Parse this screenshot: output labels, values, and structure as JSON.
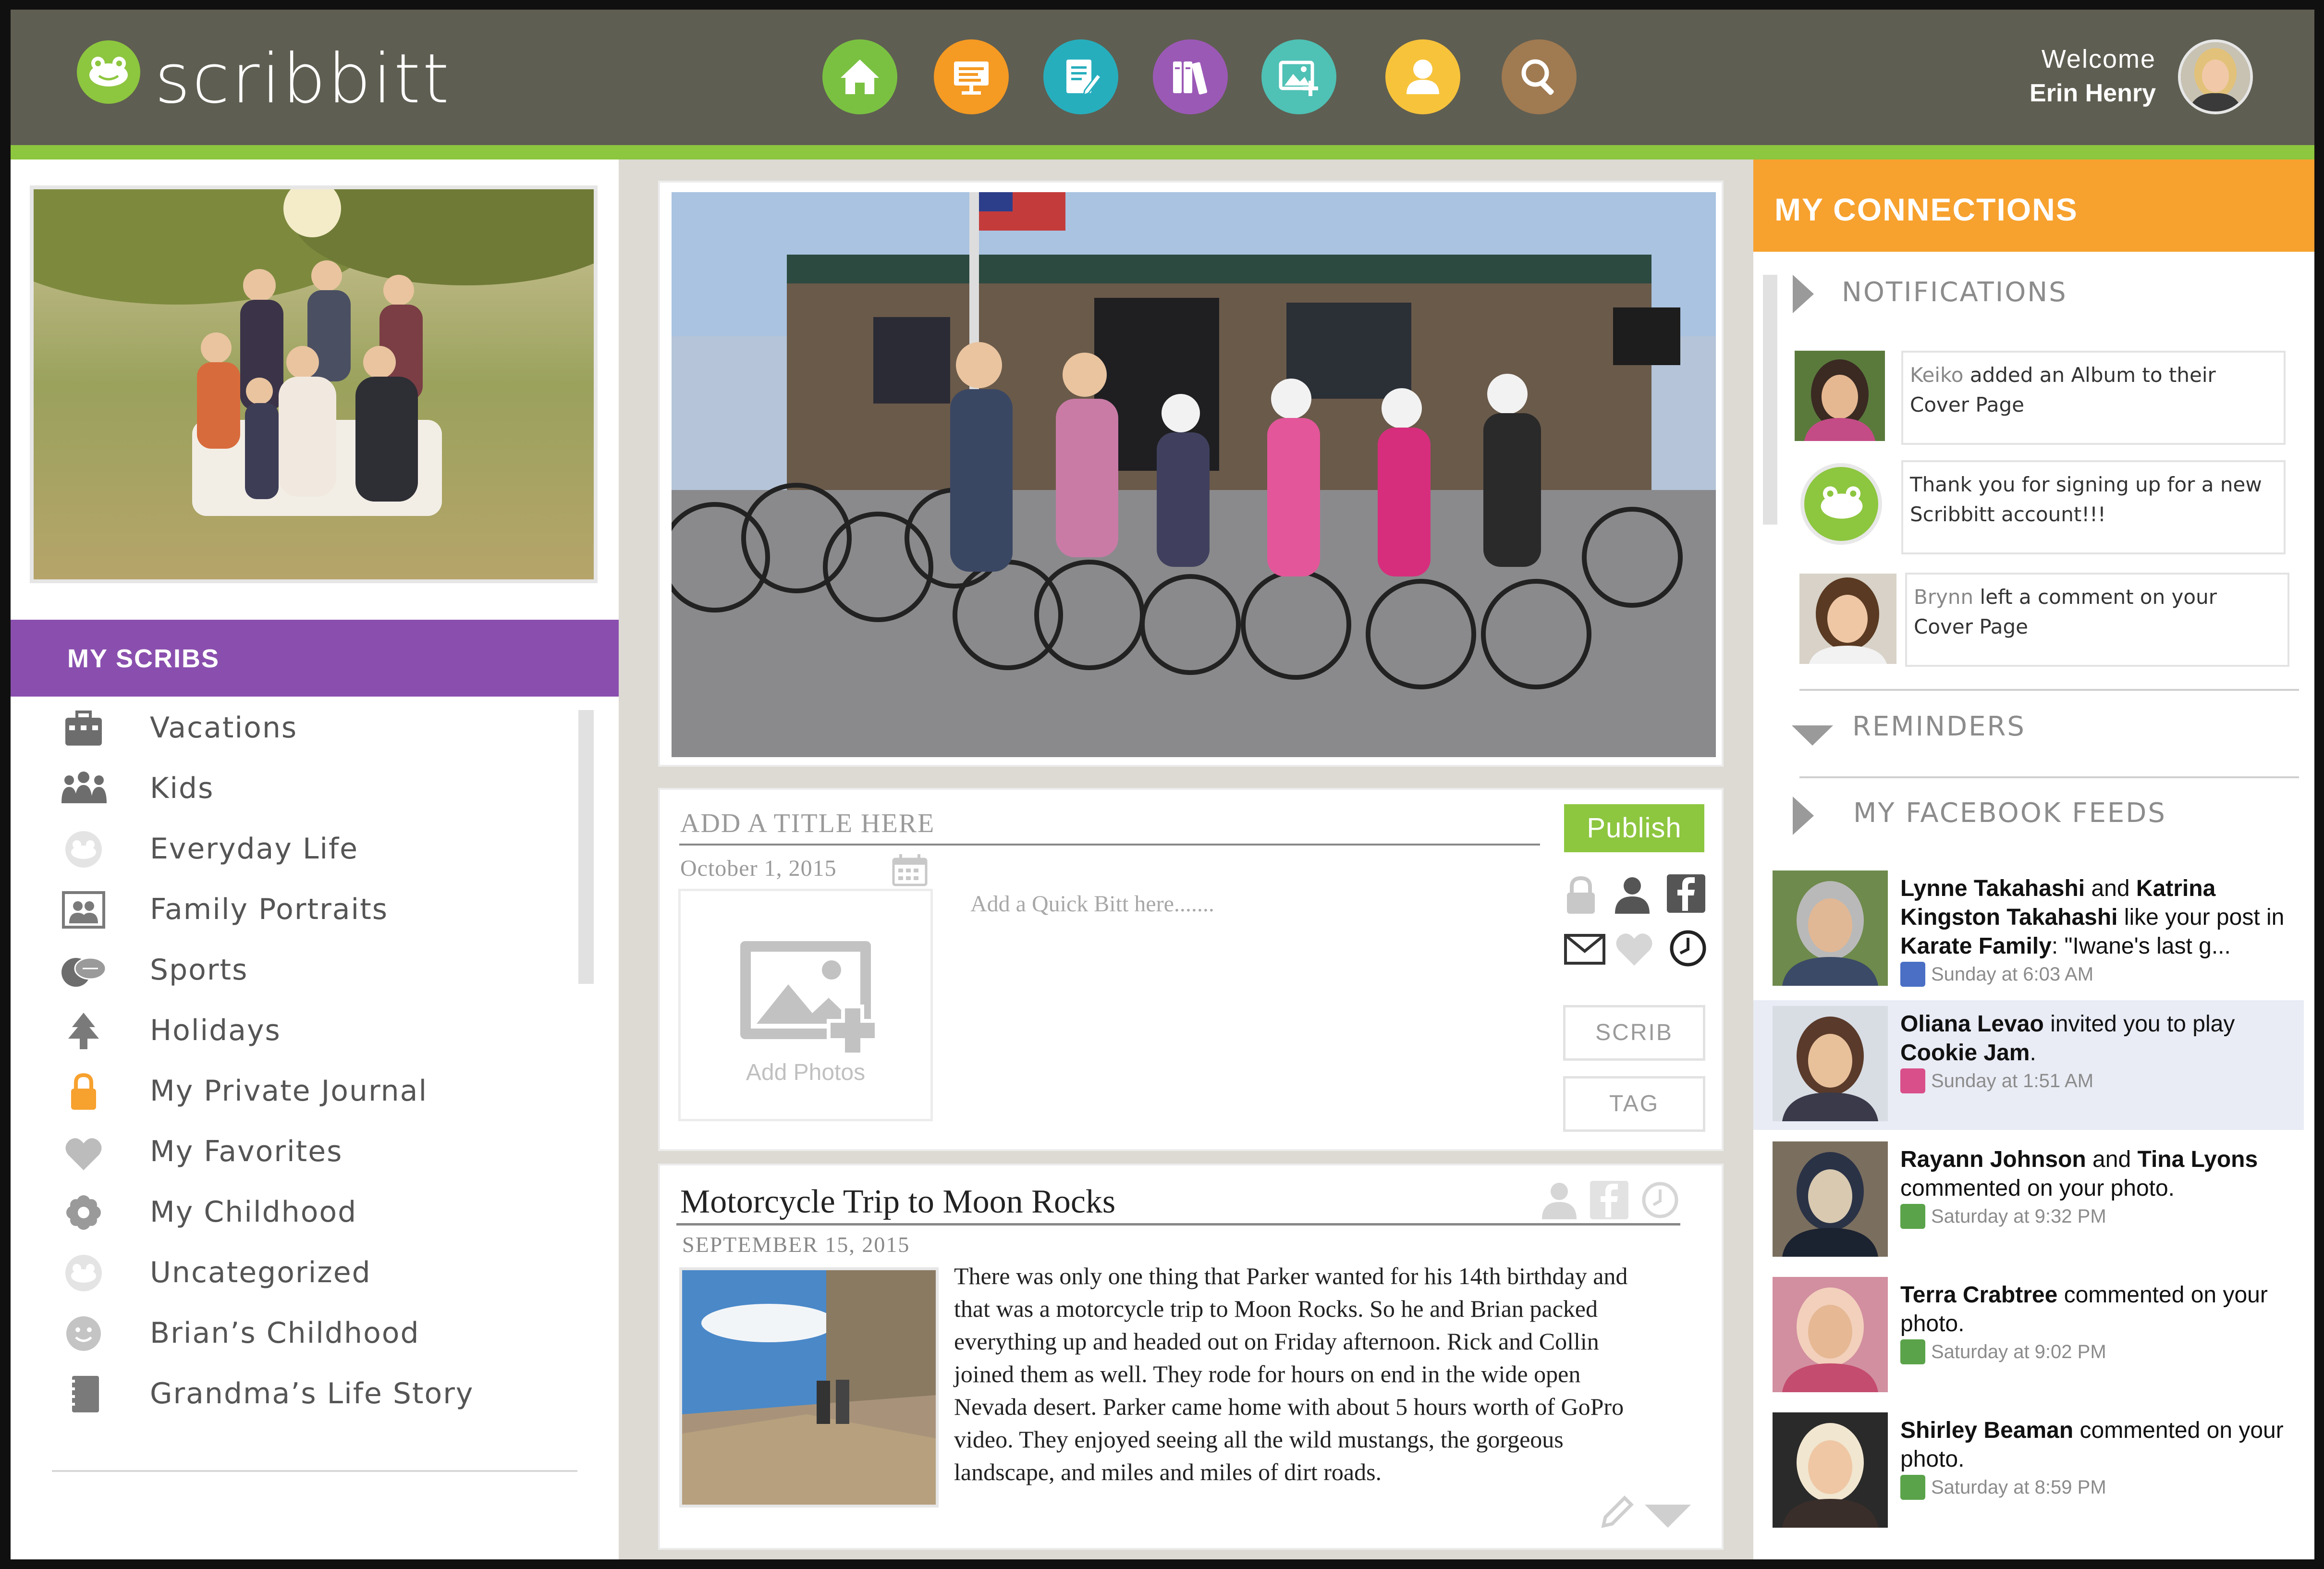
{
  "app": {
    "brand": "scribbitt",
    "colors": {
      "topbar": "#5f5e52",
      "accent_green": "#8dc63f",
      "purple": "#8a4fae",
      "orange": "#f7a12e"
    }
  },
  "header": {
    "welcome_label": "Welcome",
    "user_name": "Erin Henry",
    "nav": [
      {
        "icon": "home-icon",
        "color": "#7ac142"
      },
      {
        "icon": "presentation-icon",
        "color": "#f59a23"
      },
      {
        "icon": "edit-note-icon",
        "color": "#27aebd"
      },
      {
        "icon": "books-icon",
        "color": "#9b59b6"
      },
      {
        "icon": "add-photo-icon",
        "color": "#4fc1b5"
      },
      {
        "icon": "person-icon",
        "color": "#f7c33b"
      },
      {
        "icon": "search-icon",
        "color": "#a07a51"
      }
    ]
  },
  "sidebar": {
    "section_title": "MY SCRIBS",
    "items": [
      {
        "label": "Vacations",
        "icon": "suitcase-icon"
      },
      {
        "label": "Kids",
        "icon": "kids-icon"
      },
      {
        "label": "Everyday Life",
        "icon": "frog-icon"
      },
      {
        "label": "Family Portraits",
        "icon": "portrait-icon"
      },
      {
        "label": "Sports",
        "icon": "sports-icon"
      },
      {
        "label": "Holidays",
        "icon": "tree-icon"
      },
      {
        "label": "My Private Journal",
        "icon": "lock-icon"
      },
      {
        "label": "My Favorites",
        "icon": "heart-icon"
      },
      {
        "label": "My Childhood",
        "icon": "flower-icon"
      },
      {
        "label": "Uncategorized",
        "icon": "frog-icon"
      },
      {
        "label": "Brian’s Childhood",
        "icon": "smiley-icon"
      },
      {
        "label": "Grandma’s Life Story",
        "icon": "notebook-icon"
      }
    ]
  },
  "composer": {
    "title_placeholder": "ADD A TITLE HERE",
    "date": "October 1, 2015",
    "add_photos": "Add Photos",
    "quick_bitt_placeholder": "Add a Quick Bitt here.......",
    "publish": "Publish",
    "scrib": "SCRIB",
    "tag": "TAG"
  },
  "post": {
    "title": "Motorcycle Trip to Moon Rocks",
    "date": "SEPTEMBER 15, 2015",
    "body": "There was only one thing that Parker wanted for his 14th birthday and that was a motorcycle trip to Moon Rocks. So he and Brian packed everything up and headed out on Friday afternoon. Rick and Collin joined them as well. They rode for hours on end in the wide open Nevada desert. Parker came home with about 5 hours worth of GoPro video. They enjoyed seeing all the wild mustangs, the gorgeous landscape, and miles and miles of dirt roads."
  },
  "connections": {
    "title": "MY CONNECTIONS",
    "notifications_label": "NOTIFICATIONS",
    "reminders_label": "REMINDERS",
    "facebook_label": "MY FACEBOOK FEEDS",
    "notifications": [
      {
        "name": "Keiko",
        "text": " added an Album to their Cover Page"
      },
      {
        "name": "",
        "text": "Thank you for signing up for a new Scribbitt account!!!"
      },
      {
        "name": "Brynn",
        "text": " left a comment on your Cover Page"
      }
    ],
    "feeds": [
      {
        "a": "Lynne Takahashi",
        "mid": " and ",
        "b": "Katrina Kingston Takahashi",
        "rest": " like your post in ",
        "c": "Karate Family",
        "tail": ": \"Iwane's last g...",
        "time": "Sunday at 6:03 AM",
        "icon": "like-icon"
      },
      {
        "a": "Oliana Levao",
        "mid": " invited you to play ",
        "b": "Cookie Jam",
        "rest": ".",
        "c": "",
        "tail": "",
        "time": "Sunday at 1:51 AM",
        "icon": "game-icon"
      },
      {
        "a": "Rayann Johnson",
        "mid": " and ",
        "b": "Tina Lyons",
        "rest": " commented on your photo.",
        "c": "",
        "tail": "",
        "time": "Saturday at 9:32 PM",
        "icon": "comment-icon"
      },
      {
        "a": "Terra Crabtree",
        "mid": " commented on your photo.",
        "b": "",
        "rest": "",
        "c": "",
        "tail": "",
        "time": "Saturday at 9:02 PM",
        "icon": "comment-icon"
      },
      {
        "a": "Shirley Beaman",
        "mid": " commented on your photo.",
        "b": "",
        "rest": "",
        "c": "",
        "tail": "",
        "time": "Saturday at 8:59 PM",
        "icon": "comment-icon"
      }
    ]
  }
}
